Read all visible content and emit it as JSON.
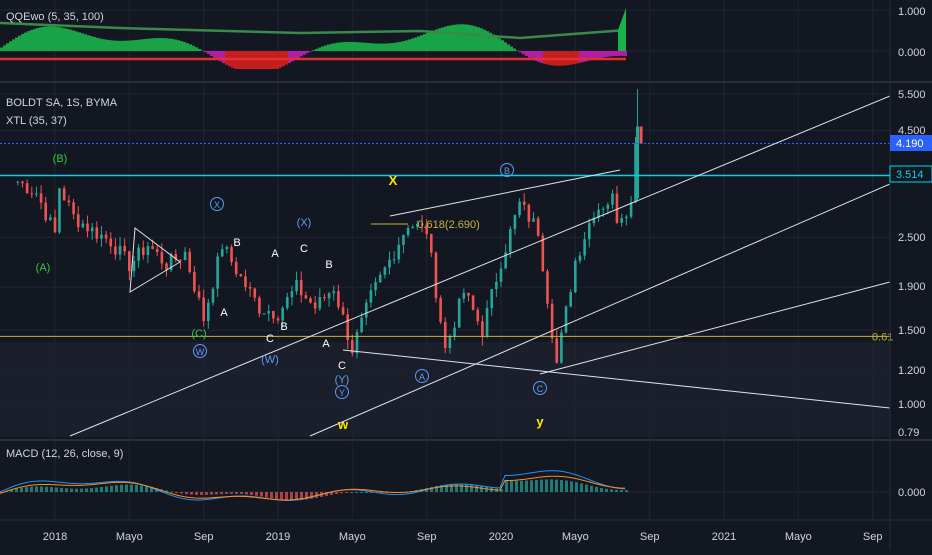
{
  "colors": {
    "background": "#131722",
    "grid": "#1f2433",
    "separator": "#2a2e39",
    "text": "#d1d4dc",
    "up": "#26a69a",
    "down": "#ef5350",
    "cyan": "#00d5e6",
    "blue_dotted": "#2962ff",
    "fib": "#c8b43c",
    "wave_green": "#2ecc40",
    "wave_white": "#ffffff",
    "wave_blue": "#5b9cf6",
    "wave_yellow": "#ffe600",
    "macd_line": "#2196f3",
    "signal_line": "#ff8c1a"
  },
  "panes": {
    "qqe": {
      "label": "QQEwo (5, 35, 100)",
      "axis": [
        "1.000",
        "0.000"
      ]
    },
    "price": {
      "symbol": "BOLDT SA, 1S, BYMA",
      "indicator": "XTL (35, 37)",
      "axis": [
        "5.500",
        "4.500",
        "2.500",
        "1.900",
        "1.500",
        "1.200",
        "1.000",
        "0.79"
      ],
      "last_price_badge": "4.190",
      "level_badge": "3.514",
      "fib_label": "0.618(2.690)",
      "fib_level_cut": "0.61"
    },
    "macd": {
      "label": "MACD (12, 26, close, 9)",
      "axis": [
        "0.000"
      ]
    }
  },
  "time_axis": [
    "2018",
    "Mayo",
    "Sep",
    "2019",
    "Mayo",
    "Sep",
    "2020",
    "Mayo",
    "Sep",
    "2021",
    "Mayo",
    "Sep"
  ],
  "wave_labels": [
    {
      "text": "(B)",
      "color": "green"
    },
    {
      "text": "(A)",
      "color": "green"
    },
    {
      "text": "X",
      "color": "blue",
      "circled": true
    },
    {
      "text": "B",
      "color": "white"
    },
    {
      "text": "A",
      "color": "white"
    },
    {
      "text": "(C)",
      "color": "green"
    },
    {
      "text": "W",
      "color": "blue",
      "circled": true
    },
    {
      "text": "(X)",
      "color": "blue"
    },
    {
      "text": "C",
      "color": "white"
    },
    {
      "text": "A",
      "color": "white"
    },
    {
      "text": "B",
      "color": "white"
    },
    {
      "text": "B",
      "color": "white"
    },
    {
      "text": "C",
      "color": "white"
    },
    {
      "text": "(W)",
      "color": "blue"
    },
    {
      "text": "A",
      "color": "white"
    },
    {
      "text": "C",
      "color": "white"
    },
    {
      "text": "(Y)",
      "color": "blue"
    },
    {
      "text": "Y",
      "color": "blue",
      "circled": true
    },
    {
      "text": "w",
      "color": "yellow"
    },
    {
      "text": "X",
      "color": "yellow"
    },
    {
      "text": "A",
      "color": "blue",
      "circled": true
    },
    {
      "text": "B",
      "color": "blue",
      "circled": true
    },
    {
      "text": "C",
      "color": "blue",
      "circled": true
    },
    {
      "text": "y",
      "color": "yellow"
    }
  ],
  "chart_data": {
    "type": "candlestick",
    "title": "BOLDT SA, 1S, BYMA",
    "y_scale": "log",
    "ylim": [
      0.75,
      5.7
    ],
    "x_range": [
      "2017-10",
      "2021-11"
    ],
    "last_price": 4.19,
    "horizontal_levels": [
      {
        "value": 3.514,
        "label": "3.514"
      },
      {
        "value": 4.19,
        "label": "4.190"
      },
      {
        "value": 1.45,
        "label": "0.61"
      },
      {
        "value": 2.69,
        "label": "0.618(2.690)"
      }
    ],
    "price_path": [
      {
        "t": "2017-11",
        "v": 3.4
      },
      {
        "t": "2017-12",
        "v": 3.2
      },
      {
        "t": "2018-01",
        "v": 2.55
      },
      {
        "t": "2018-01",
        "v": 3.3
      },
      {
        "t": "2018-02",
        "v": 2.8
      },
      {
        "t": "2018-03",
        "v": 2.6
      },
      {
        "t": "2018-04",
        "v": 2.45
      },
      {
        "t": "2018-05",
        "v": 2.15
      },
      {
        "t": "2018-06",
        "v": 2.4
      },
      {
        "t": "2018-07",
        "v": 2.15
      },
      {
        "t": "2018-08",
        "v": 2.3
      },
      {
        "t": "2018-09",
        "v": 1.6
      },
      {
        "t": "2018-10",
        "v": 2.4
      },
      {
        "t": "2018-11",
        "v": 2.0
      },
      {
        "t": "2018-12",
        "v": 1.7
      },
      {
        "t": "2019-01",
        "v": 1.65
      },
      {
        "t": "2019-02",
        "v": 1.9
      },
      {
        "t": "2019-03",
        "v": 1.7
      },
      {
        "t": "2019-04",
        "v": 1.9
      },
      {
        "t": "2019-05",
        "v": 1.35
      },
      {
        "t": "2019-06",
        "v": 1.8
      },
      {
        "t": "2019-07",
        "v": 2.2
      },
      {
        "t": "2019-08",
        "v": 2.7
      },
      {
        "t": "2019-09",
        "v": 2.6
      },
      {
        "t": "2019-10",
        "v": 1.35
      },
      {
        "t": "2019-11",
        "v": 1.85
      },
      {
        "t": "2019-12",
        "v": 1.5
      },
      {
        "t": "2020-01",
        "v": 2.2
      },
      {
        "t": "2020-02",
        "v": 3.0
      },
      {
        "t": "2020-03",
        "v": 2.6
      },
      {
        "t": "2020-04",
        "v": 1.25
      },
      {
        "t": "2020-05",
        "v": 2.2
      },
      {
        "t": "2020-06",
        "v": 2.9
      },
      {
        "t": "2020-07",
        "v": 3.1
      },
      {
        "t": "2020-07",
        "v": 2.8
      },
      {
        "t": "2020-08",
        "v": 3.0
      },
      {
        "t": "2020-08",
        "v": 4.19
      }
    ],
    "annotations": [
      "(B)",
      "(A)",
      "X",
      "W",
      "(X)",
      "(C)",
      "(W)",
      "(Y)",
      "Y",
      "w",
      "X",
      "A",
      "B",
      "C",
      "y"
    ],
    "indicators": {
      "qqe": {
        "name": "QQEwo (5, 35, 100)",
        "ylim": [
          -0.2,
          1.0
        ]
      },
      "macd": {
        "name": "MACD (12, 26, close, 9)"
      },
      "xtl": {
        "name": "XTL (35, 37)"
      }
    }
  }
}
